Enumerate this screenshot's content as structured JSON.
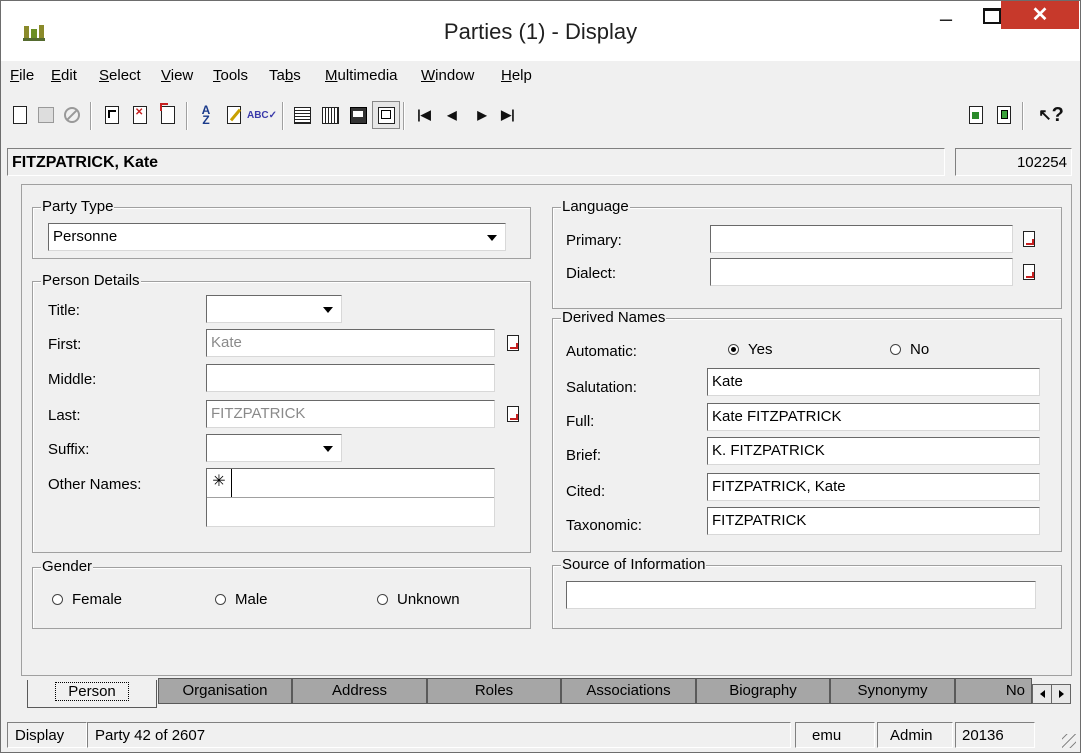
{
  "window": {
    "title": "Parties (1) - Display",
    "minimize": "–",
    "close": "✕"
  },
  "menubar": [
    {
      "label": "File",
      "underline": "F",
      "rest": "ile"
    },
    {
      "label": "Edit",
      "underline": "E",
      "rest": "dit"
    },
    {
      "label": "Select",
      "underline": "S",
      "rest": "elect"
    },
    {
      "label": "View",
      "underline": "V",
      "rest": "iew"
    },
    {
      "label": "Tools",
      "underline": "T",
      "rest": "ools"
    },
    {
      "label": "Tabs",
      "pre": "Ta",
      "underline": "b",
      "rest": "s"
    },
    {
      "label": "Multimedia",
      "underline": "M",
      "rest": "ultimedia"
    },
    {
      "label": "Window",
      "underline": "W",
      "rest": "indow"
    },
    {
      "label": "Help",
      "underline": "H",
      "rest": "elp"
    }
  ],
  "toolbar": {
    "icons": [
      "new-record-icon",
      "save-icon",
      "cancel-icon",
      "go-to-record-icon",
      "delete-record-icon",
      "new-version-icon",
      "sort-icon",
      "edit-icon",
      "spell-check-icon",
      "list-view-icon",
      "grid-view-icon",
      "report-view-icon",
      "detail-view-icon",
      "first-record-icon",
      "previous-record-icon",
      "next-record-icon",
      "last-record-icon",
      "attach-icon",
      "copy-record-icon",
      "context-help-icon"
    ],
    "help_glyph": "?"
  },
  "record": {
    "name": "FITZPATRICK, Kate",
    "id": "102254"
  },
  "party_type": {
    "label": "Party Type",
    "value": "Personne"
  },
  "person_details": {
    "label": "Person Details",
    "title_label": "Title:",
    "title_value": "",
    "first_label": "First:",
    "first_value": "Kate",
    "middle_label": "Middle:",
    "middle_value": "",
    "last_label": "Last:",
    "last_value": "FITZPATRICK",
    "suffix_label": "Suffix:",
    "suffix_value": "",
    "other_names_label": "Other Names:",
    "other_names_marker": "✳"
  },
  "gender": {
    "label": "Gender",
    "options": [
      "Female",
      "Male",
      "Unknown"
    ],
    "selected": null
  },
  "language": {
    "label": "Language",
    "primary_label": "Primary:",
    "primary_value": "",
    "dialect_label": "Dialect:",
    "dialect_value": ""
  },
  "derived_names": {
    "label": "Derived Names",
    "automatic_label": "Automatic:",
    "yes": "Yes",
    "no": "No",
    "automatic_selected": "Yes",
    "salutation_label": "Salutation:",
    "salutation_value": "Kate",
    "full_label": "Full:",
    "full_value": "Kate FITZPATRICK",
    "brief_label": "Brief:",
    "brief_value": "K. FITZPATRICK",
    "cited_label": "Cited:",
    "cited_value": "FITZPATRICK, Kate",
    "taxonomic_label": "Taxonomic:",
    "taxonomic_value": "FITZPATRICK"
  },
  "source": {
    "label": "Source of Information",
    "value": ""
  },
  "tabs": [
    {
      "label": "Person",
      "active": true
    },
    {
      "label": "Organisation"
    },
    {
      "label": "Address"
    },
    {
      "label": "Roles"
    },
    {
      "label": "Associations"
    },
    {
      "label": "Biography"
    },
    {
      "label": "Synonymy"
    },
    {
      "label": "No"
    }
  ],
  "status": {
    "mode": "Display",
    "position": "Party 42 of 2607",
    "db": "emu",
    "user": "Admin",
    "number": "20136"
  },
  "colors": {
    "close_button": "#c7392b",
    "inactive_tab": "#a6a6a6",
    "background": "#f0f0f0"
  }
}
